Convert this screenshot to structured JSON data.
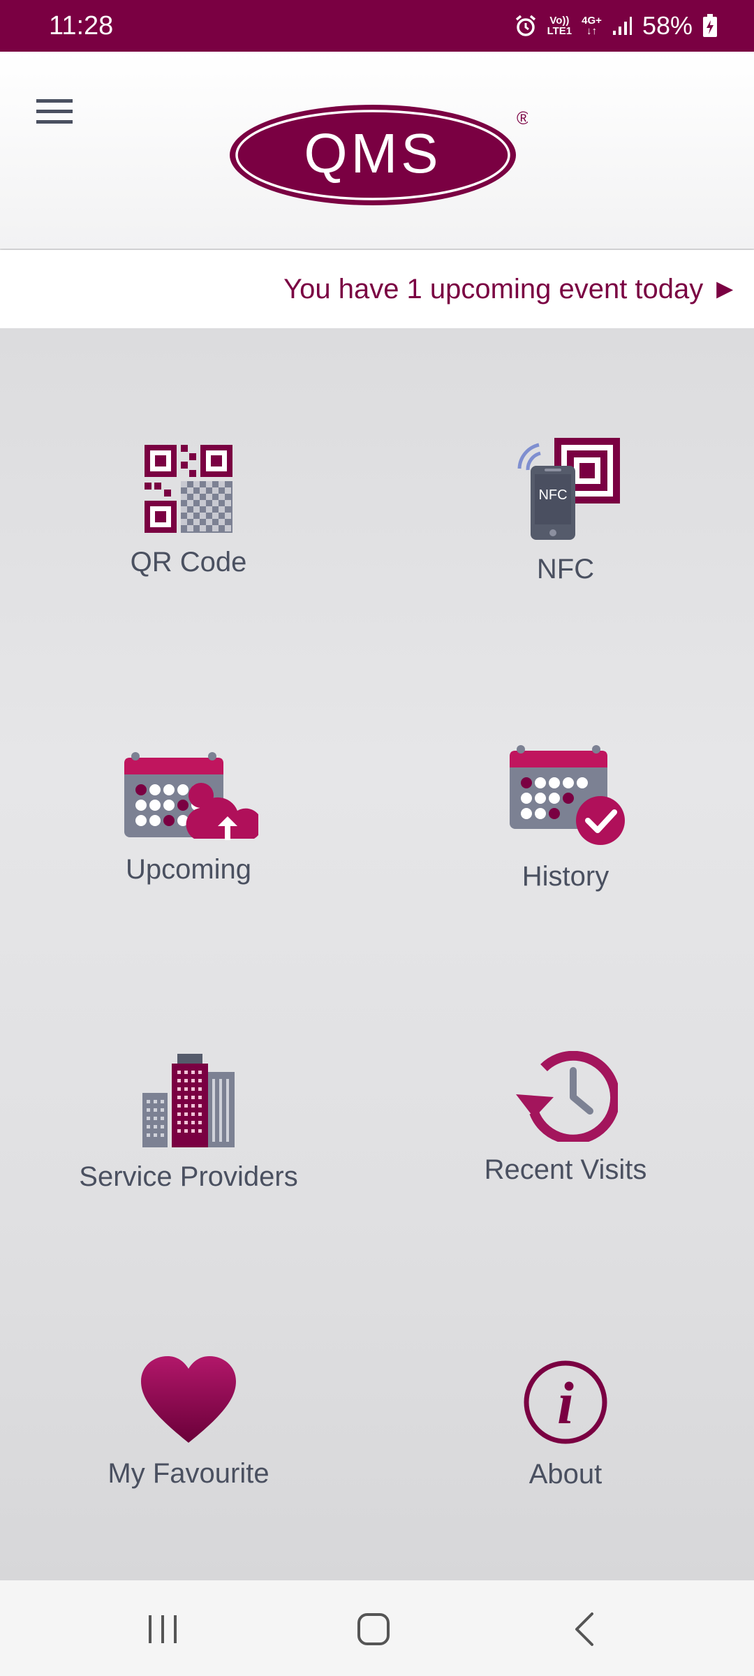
{
  "status_bar": {
    "time": "11:28",
    "network_top": "Vo))",
    "network_bottom": "LTE1",
    "network_type": "4G+",
    "battery": "58%",
    "background": "#7a0042"
  },
  "app_bar": {
    "logo_text": "QMS",
    "registered_mark": "®",
    "menu_icon": "hamburger-menu-icon"
  },
  "banner": {
    "text": "You have 1 upcoming event today ►",
    "color": "#7a0042"
  },
  "tiles": [
    {
      "label": "QR Code",
      "icon": "qr-code-icon"
    },
    {
      "label": "NFC",
      "icon": "nfc-phone-icon",
      "icon_text": "NFC"
    },
    {
      "label": "Upcoming",
      "icon": "calendar-upload-icon"
    },
    {
      "label": "History",
      "icon": "calendar-check-icon"
    },
    {
      "label": "Service Providers",
      "icon": "buildings-icon"
    },
    {
      "label": "Recent Visits",
      "icon": "clock-history-icon"
    },
    {
      "label": "My Favourite",
      "icon": "heart-icon"
    },
    {
      "label": "About",
      "icon": "info-icon",
      "icon_text": "i"
    }
  ],
  "nav_bar": {
    "recent_icon": "recent-apps-icon",
    "home_icon": "home-icon",
    "back_icon": "back-icon"
  },
  "colors": {
    "brand": "#7a0042",
    "accent": "#a3155c",
    "icon_grey": "#7c8193",
    "text": "#4a5060"
  }
}
